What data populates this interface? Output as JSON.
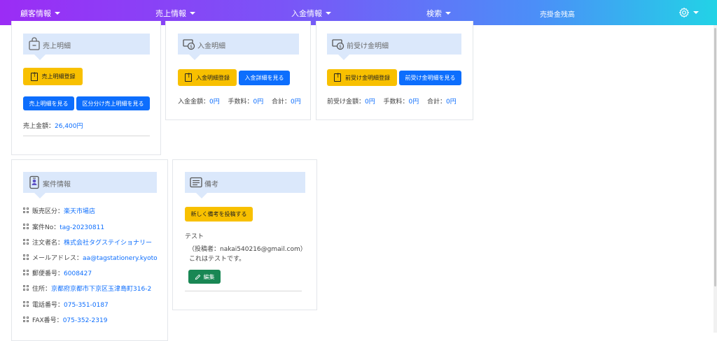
{
  "nav": {
    "items": [
      {
        "label": "顧客情報",
        "caret": true
      },
      {
        "label": "売上情報",
        "caret": true
      },
      {
        "label": "入金情報",
        "caret": true
      },
      {
        "label": "検索",
        "caret": true
      },
      {
        "label": "売掛金残高",
        "caret": false
      }
    ],
    "settings_icon": "gear-icon"
  },
  "sales": {
    "title": "売上明細",
    "icon": "shopping-bag-icon",
    "register_label": "売上明細登録",
    "view_label": "売上明細を見る",
    "view_split_label": "区分分け売上明細を見る",
    "total_label": "売上金額：",
    "total_value": "26,400円"
  },
  "payment": {
    "title": "入金明細",
    "icon": "money-icon",
    "register_label": "入金明細登録",
    "view_label": "入金詳細を見る",
    "amount_label": "入金金額：",
    "amount_value": "0円",
    "fee_label": "手数料：",
    "fee_value": "0円",
    "sum_label": "合計：",
    "sum_value": "0円"
  },
  "advance": {
    "title": "前受け金明細",
    "icon": "money-icon",
    "register_label": "前受け金明細登録",
    "view_label": "前受け金明細を見る",
    "amount_label": "前受け金額：",
    "amount_value": "0円",
    "fee_label": "手数料：",
    "fee_value": "0円",
    "sum_label": "合計：",
    "sum_value": "0円"
  },
  "case": {
    "title": "案件情報",
    "icon": "id-badge-icon",
    "fields": [
      {
        "label": "販売区分：",
        "value": "楽天市場店"
      },
      {
        "label": "案件No：",
        "value": "tag-20230811"
      },
      {
        "label": "注文者名：",
        "value": "株式会社タグステイショナリー"
      },
      {
        "label": "メールアドレス：",
        "value": "aa@tagstationery.kyoto"
      },
      {
        "label": "郵便番号：",
        "value": "6008427"
      },
      {
        "label": "住所：",
        "value": "京都府京都市下京区玉津島町316-2"
      },
      {
        "label": "電話番号：",
        "value": "075-351-0187"
      },
      {
        "label": "FAX番号：",
        "value": "075-352-2319"
      }
    ]
  },
  "notes": {
    "title": "備考",
    "icon": "memo-icon",
    "post_label": "新しく備考を投稿する",
    "entry_text": "テスト",
    "entry_author": "（投稿者：nakai540216@gmail.com）",
    "entry_body": "これはテストです。",
    "edit_label": "編集"
  }
}
